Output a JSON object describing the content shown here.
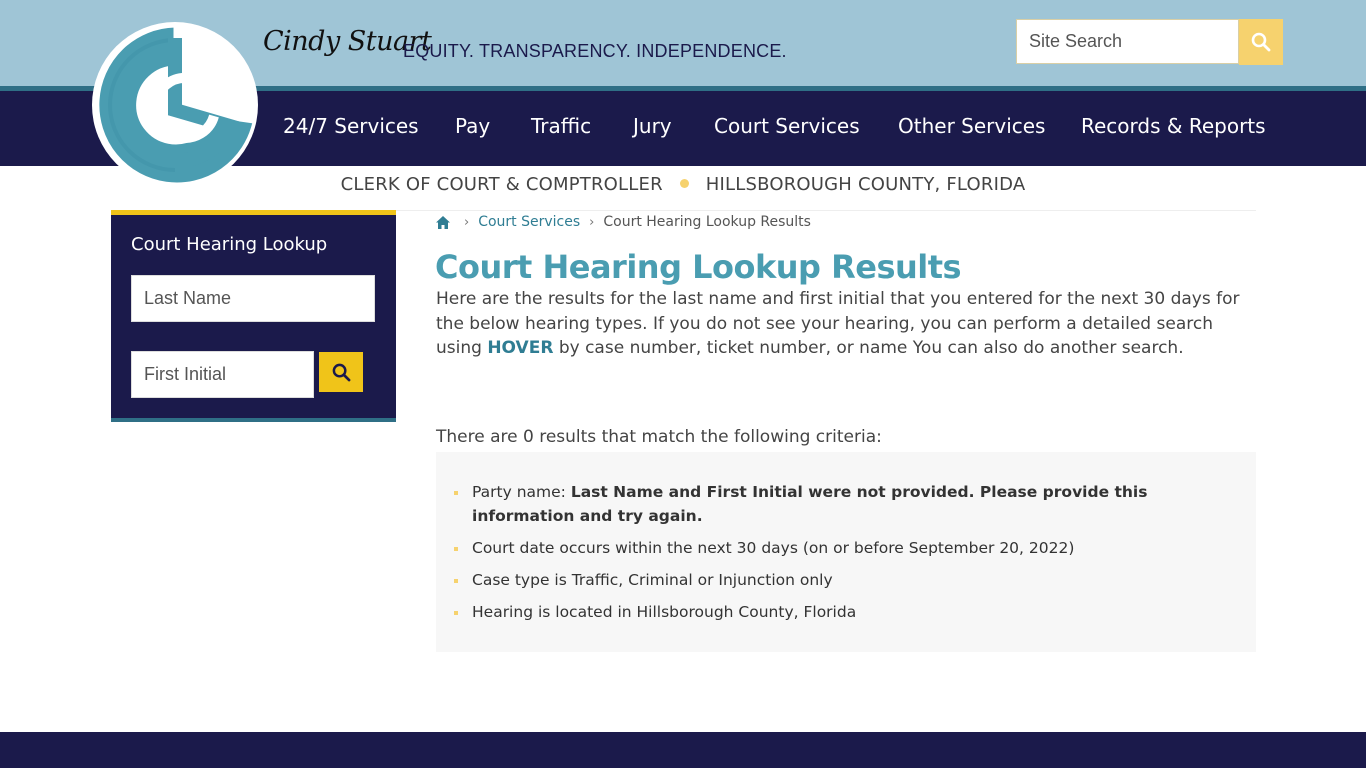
{
  "header": {
    "signature": "Cindy Stuart",
    "tagline": "EQUITY. TRANSPARENCY. INDEPENDENCE.",
    "search_placeholder": "Site Search",
    "search_icon": "search-icon"
  },
  "nav": {
    "items": [
      "24/7 Services",
      "Pay",
      "Traffic",
      "Jury",
      "Court Services",
      "Other Services",
      "Records & Reports"
    ]
  },
  "subheader": {
    "left": "CLERK OF COURT & COMPTROLLER",
    "right": "HILLSBOROUGH COUNTY, FLORIDA"
  },
  "sidebar": {
    "title": "Court Hearing Lookup",
    "last_name_placeholder": "Last Name",
    "first_initial_placeholder": "First Initial"
  },
  "breadcrumb": {
    "home_icon": "home-icon",
    "items": [
      "Court Services",
      "Court Hearing Lookup Results"
    ]
  },
  "main": {
    "title": "Court Hearing Lookup Results",
    "intro_before": "Here are the results for the last name and first initial that you entered for the next 30 days for the below hearing types. If you do not see your hearing, you can perform a detailed search using ",
    "intro_link": "HOVER",
    "intro_after": " by case number, ticket number, or name You can also do another search.",
    "result_count": "There are 0 results that match the following criteria:",
    "criteria": [
      {
        "label": "Party name: ",
        "value": "Last Name and First Initial were not provided. Please provide this information and try again."
      },
      {
        "label": "Court date occurs within the next 30 days (on or before September 20, 2022)",
        "value": ""
      },
      {
        "label": "Case type is Traffic, Criminal or Injunction only",
        "value": ""
      },
      {
        "label": "Hearing is located in Hillsborough County, Florida",
        "value": ""
      }
    ]
  },
  "colors": {
    "navy": "#1b1a4b",
    "sky": "#9fc5d6",
    "teal": "#4a9db1",
    "gold": "#f0c419"
  }
}
